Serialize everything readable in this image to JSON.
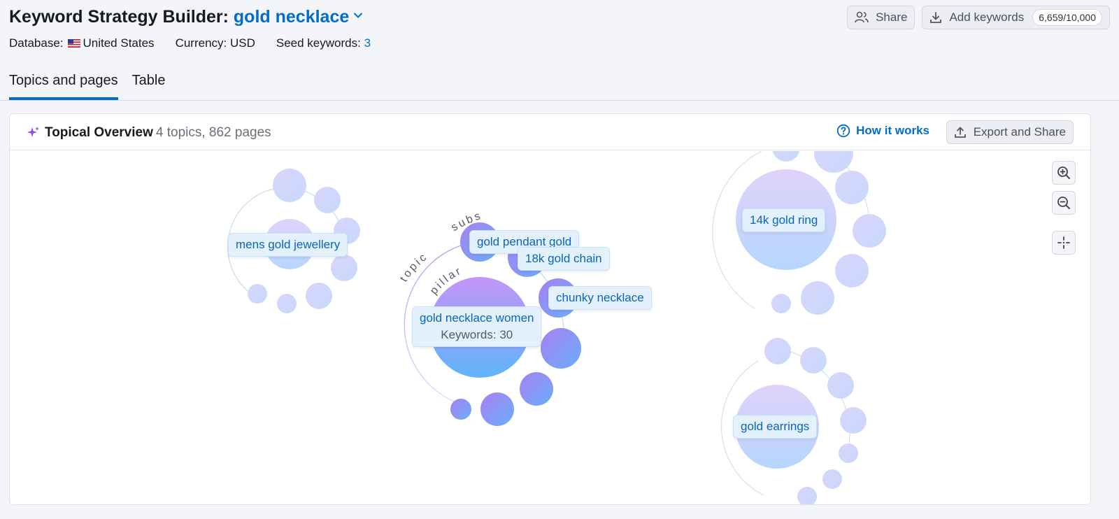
{
  "header": {
    "title_prefix": "Keyword Strategy Builder:",
    "keyword": "gold necklace",
    "share_label": "Share",
    "add_keywords_label": "Add keywords",
    "keyword_counter": "6,659/10,000"
  },
  "meta": {
    "database_label": "Database:",
    "database_value": "United States",
    "currency": "Currency: USD",
    "seed_label": "Seed keywords:",
    "seed_count": "3"
  },
  "tabs": [
    {
      "label": "Topics and pages",
      "active": true
    },
    {
      "label": "Table",
      "active": false
    }
  ],
  "panel": {
    "title": "Topical Overview",
    "subtitle": "4 topics, 862 pages",
    "how_label": "How it works",
    "export_label": "Export and Share"
  },
  "map": {
    "arc_labels": {
      "subs": "subs",
      "topic": "topic",
      "pillar": "pillar"
    },
    "topics": [
      {
        "label": "mens gold jewellery"
      },
      {
        "label": "gold necklace women",
        "keywords": "Keywords: 30"
      },
      {
        "label": "14k gold ring"
      },
      {
        "label": "gold earrings"
      }
    ],
    "subtopics": [
      {
        "label": "gold pendant gold"
      },
      {
        "label": "18k gold chain"
      },
      {
        "label": "chunky necklace"
      }
    ]
  },
  "colors": {
    "accent": "#006dca",
    "label_bg": "#e3f1fd",
    "bubble_purple": "#b593f7",
    "bubble_blue": "#5fb4fb"
  },
  "icons": [
    "chevron-down-icon",
    "users-icon",
    "download-icon",
    "us-flag-icon",
    "sparkle-icon",
    "help-circle-icon",
    "upload-icon",
    "zoom-in-icon",
    "zoom-out-icon",
    "recenter-icon"
  ]
}
